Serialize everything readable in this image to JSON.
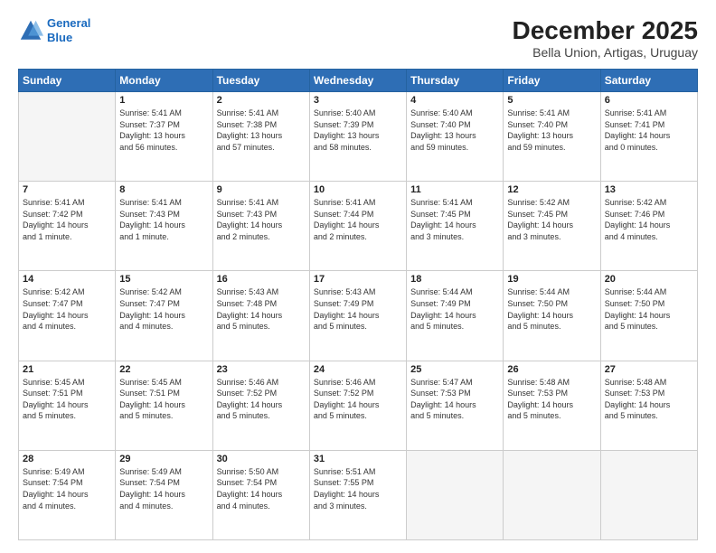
{
  "header": {
    "logo_line1": "General",
    "logo_line2": "Blue",
    "title": "December 2025",
    "subtitle": "Bella Union, Artigas, Uruguay"
  },
  "calendar": {
    "days_of_week": [
      "Sunday",
      "Monday",
      "Tuesday",
      "Wednesday",
      "Thursday",
      "Friday",
      "Saturday"
    ],
    "weeks": [
      [
        {
          "day": "",
          "info": ""
        },
        {
          "day": "1",
          "info": "Sunrise: 5:41 AM\nSunset: 7:37 PM\nDaylight: 13 hours\nand 56 minutes."
        },
        {
          "day": "2",
          "info": "Sunrise: 5:41 AM\nSunset: 7:38 PM\nDaylight: 13 hours\nand 57 minutes."
        },
        {
          "day": "3",
          "info": "Sunrise: 5:40 AM\nSunset: 7:39 PM\nDaylight: 13 hours\nand 58 minutes."
        },
        {
          "day": "4",
          "info": "Sunrise: 5:40 AM\nSunset: 7:40 PM\nDaylight: 13 hours\nand 59 minutes."
        },
        {
          "day": "5",
          "info": "Sunrise: 5:41 AM\nSunset: 7:40 PM\nDaylight: 13 hours\nand 59 minutes."
        },
        {
          "day": "6",
          "info": "Sunrise: 5:41 AM\nSunset: 7:41 PM\nDaylight: 14 hours\nand 0 minutes."
        }
      ],
      [
        {
          "day": "7",
          "info": "Sunrise: 5:41 AM\nSunset: 7:42 PM\nDaylight: 14 hours\nand 1 minute."
        },
        {
          "day": "8",
          "info": "Sunrise: 5:41 AM\nSunset: 7:43 PM\nDaylight: 14 hours\nand 1 minute."
        },
        {
          "day": "9",
          "info": "Sunrise: 5:41 AM\nSunset: 7:43 PM\nDaylight: 14 hours\nand 2 minutes."
        },
        {
          "day": "10",
          "info": "Sunrise: 5:41 AM\nSunset: 7:44 PM\nDaylight: 14 hours\nand 2 minutes."
        },
        {
          "day": "11",
          "info": "Sunrise: 5:41 AM\nSunset: 7:45 PM\nDaylight: 14 hours\nand 3 minutes."
        },
        {
          "day": "12",
          "info": "Sunrise: 5:42 AM\nSunset: 7:45 PM\nDaylight: 14 hours\nand 3 minutes."
        },
        {
          "day": "13",
          "info": "Sunrise: 5:42 AM\nSunset: 7:46 PM\nDaylight: 14 hours\nand 4 minutes."
        }
      ],
      [
        {
          "day": "14",
          "info": "Sunrise: 5:42 AM\nSunset: 7:47 PM\nDaylight: 14 hours\nand 4 minutes."
        },
        {
          "day": "15",
          "info": "Sunrise: 5:42 AM\nSunset: 7:47 PM\nDaylight: 14 hours\nand 4 minutes."
        },
        {
          "day": "16",
          "info": "Sunrise: 5:43 AM\nSunset: 7:48 PM\nDaylight: 14 hours\nand 5 minutes."
        },
        {
          "day": "17",
          "info": "Sunrise: 5:43 AM\nSunset: 7:49 PM\nDaylight: 14 hours\nand 5 minutes."
        },
        {
          "day": "18",
          "info": "Sunrise: 5:44 AM\nSunset: 7:49 PM\nDaylight: 14 hours\nand 5 minutes."
        },
        {
          "day": "19",
          "info": "Sunrise: 5:44 AM\nSunset: 7:50 PM\nDaylight: 14 hours\nand 5 minutes."
        },
        {
          "day": "20",
          "info": "Sunrise: 5:44 AM\nSunset: 7:50 PM\nDaylight: 14 hours\nand 5 minutes."
        }
      ],
      [
        {
          "day": "21",
          "info": "Sunrise: 5:45 AM\nSunset: 7:51 PM\nDaylight: 14 hours\nand 5 minutes."
        },
        {
          "day": "22",
          "info": "Sunrise: 5:45 AM\nSunset: 7:51 PM\nDaylight: 14 hours\nand 5 minutes."
        },
        {
          "day": "23",
          "info": "Sunrise: 5:46 AM\nSunset: 7:52 PM\nDaylight: 14 hours\nand 5 minutes."
        },
        {
          "day": "24",
          "info": "Sunrise: 5:46 AM\nSunset: 7:52 PM\nDaylight: 14 hours\nand 5 minutes."
        },
        {
          "day": "25",
          "info": "Sunrise: 5:47 AM\nSunset: 7:53 PM\nDaylight: 14 hours\nand 5 minutes."
        },
        {
          "day": "26",
          "info": "Sunrise: 5:48 AM\nSunset: 7:53 PM\nDaylight: 14 hours\nand 5 minutes."
        },
        {
          "day": "27",
          "info": "Sunrise: 5:48 AM\nSunset: 7:53 PM\nDaylight: 14 hours\nand 5 minutes."
        }
      ],
      [
        {
          "day": "28",
          "info": "Sunrise: 5:49 AM\nSunset: 7:54 PM\nDaylight: 14 hours\nand 4 minutes."
        },
        {
          "day": "29",
          "info": "Sunrise: 5:49 AM\nSunset: 7:54 PM\nDaylight: 14 hours\nand 4 minutes."
        },
        {
          "day": "30",
          "info": "Sunrise: 5:50 AM\nSunset: 7:54 PM\nDaylight: 14 hours\nand 4 minutes."
        },
        {
          "day": "31",
          "info": "Sunrise: 5:51 AM\nSunset: 7:55 PM\nDaylight: 14 hours\nand 3 minutes."
        },
        {
          "day": "",
          "info": ""
        },
        {
          "day": "",
          "info": ""
        },
        {
          "day": "",
          "info": ""
        }
      ]
    ]
  }
}
